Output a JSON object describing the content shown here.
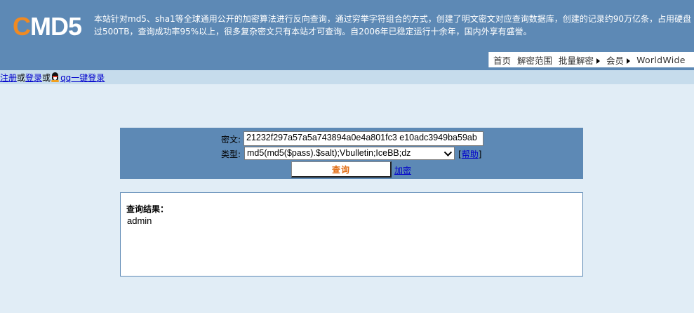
{
  "header": {
    "logo_c": "C",
    "logo_rest": "MD5",
    "intro_line1": "本站针对md5、sha1等全球通用公开的加密算法进行反向查询，通过穷举字符组合的方式，创建了明文密文对应查询数据库，创建的记录约90万亿条，占用硬盘",
    "intro_line2": "过500TB，查询成功率95%以上，很多复杂密文只有本站才可查询。自2006年已稳定运行十余年，国内外享有盛誉。",
    "nav": {
      "home": "首页",
      "scope": "解密范围",
      "batch": "批量解密",
      "member": "会员",
      "worldwide": "WorldWide"
    }
  },
  "loginbar": {
    "register": "注册",
    "or1": "或",
    "login": "登录",
    "or2": "或",
    "qq_login": "qq一键登录"
  },
  "form": {
    "cipher_label": "密文:",
    "cipher_value": "21232f297a57a5a743894a0e4a801fc3 e10adc3949ba59ab",
    "type_label": "类型:",
    "type_value": "md5(md5($pass).$salt);Vbulletin;IceBB;dz",
    "help_open": "[",
    "help_text": "帮助",
    "help_close": "]",
    "query_button": "查询",
    "encrypt_link": "加密"
  },
  "result": {
    "title": "查询结果：",
    "value": "admin"
  },
  "colors": {
    "header_bg": "#5d89b5",
    "page_bg": "#e1edf6",
    "loginbar_bg": "#c6dcec",
    "logo_accent": "#f08a22",
    "button_text": "#e06a10",
    "link": "#0000cc"
  }
}
